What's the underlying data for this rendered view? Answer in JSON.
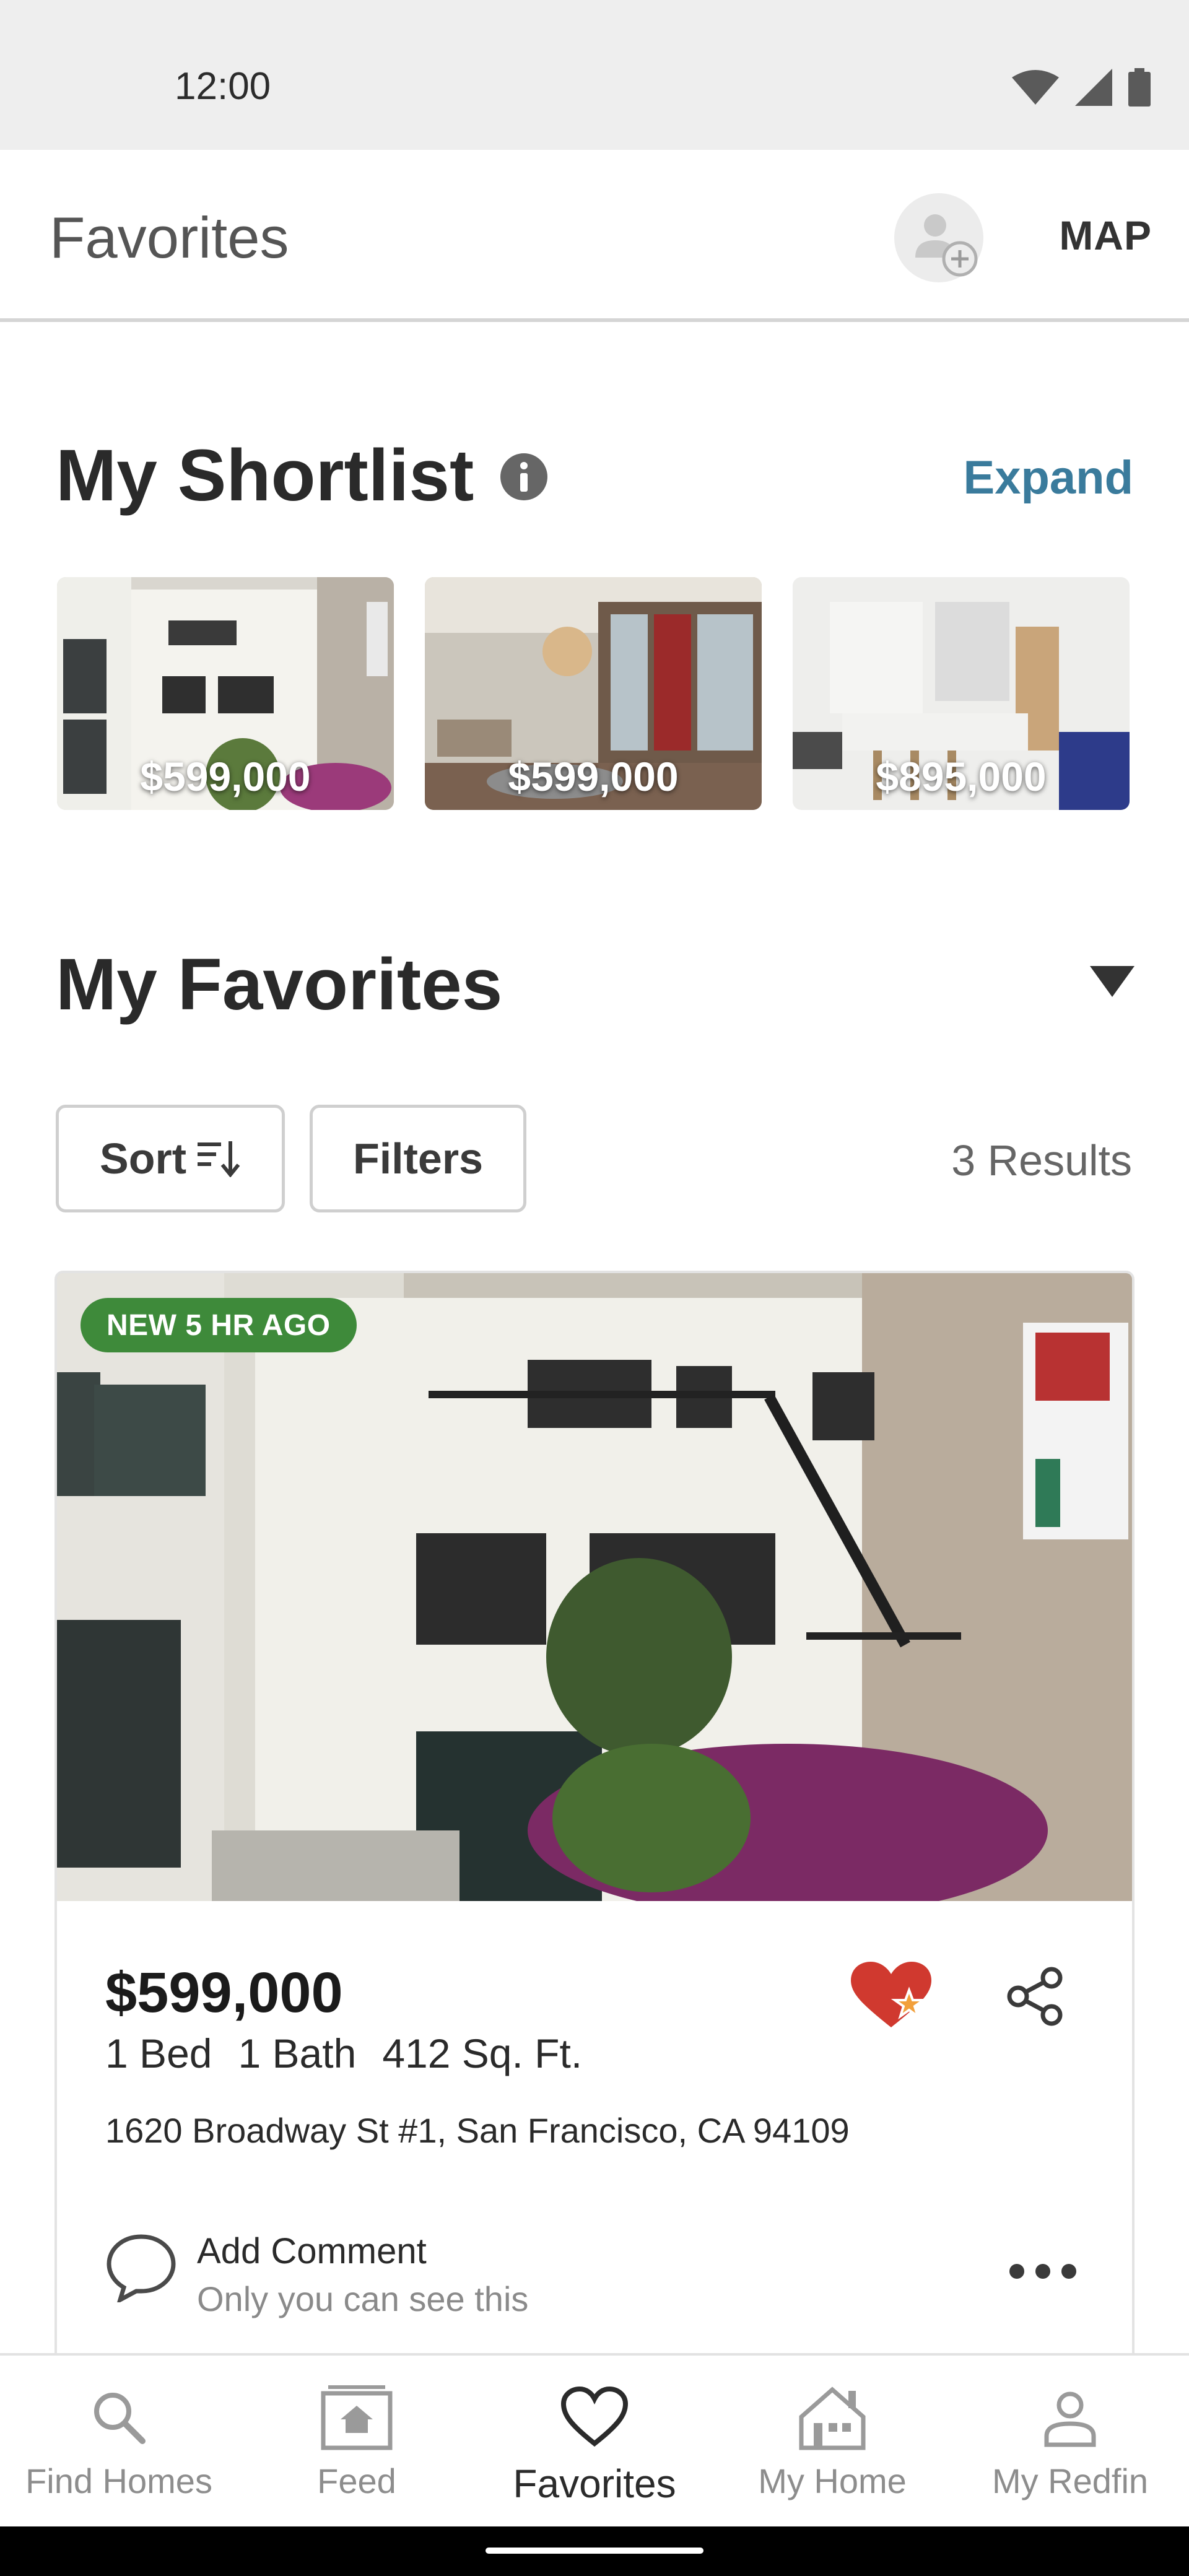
{
  "status_bar": {
    "time": "12:00"
  },
  "app_bar": {
    "title": "Favorites",
    "map_label": "MAP"
  },
  "shortlist": {
    "title": "My Shortlist",
    "expand_label": "Expand",
    "items": [
      {
        "price": "$599,000"
      },
      {
        "price": "$599,000"
      },
      {
        "price": "$895,000"
      }
    ]
  },
  "favorites": {
    "title": "My Favorites",
    "sort_label": "Sort",
    "filters_label": "Filters",
    "results": "3 Results"
  },
  "listing": {
    "badge": "NEW 5 HR AGO",
    "price": "$599,000",
    "beds": "1 Bed",
    "baths": "1 Bath",
    "sqft": "412 Sq. Ft.",
    "address": "1620 Broadway St #1, San Francisco, CA 94109",
    "comment_title": "Add Comment",
    "comment_sub": "Only you can see this"
  },
  "bottom_nav": {
    "items": [
      {
        "label": "Find Homes",
        "icon": "search-icon"
      },
      {
        "label": "Feed",
        "icon": "feed-icon"
      },
      {
        "label": "Favorites",
        "icon": "heart-icon"
      },
      {
        "label": "My Home",
        "icon": "house-icon"
      },
      {
        "label": "My Redfin",
        "icon": "person-icon"
      }
    ],
    "active_index": 2
  },
  "colors": {
    "accent_link": "#3a7b9c",
    "badge_green": "#3e8a3a",
    "heart_red": "#d0392f",
    "star_orange": "#f2a03b"
  }
}
